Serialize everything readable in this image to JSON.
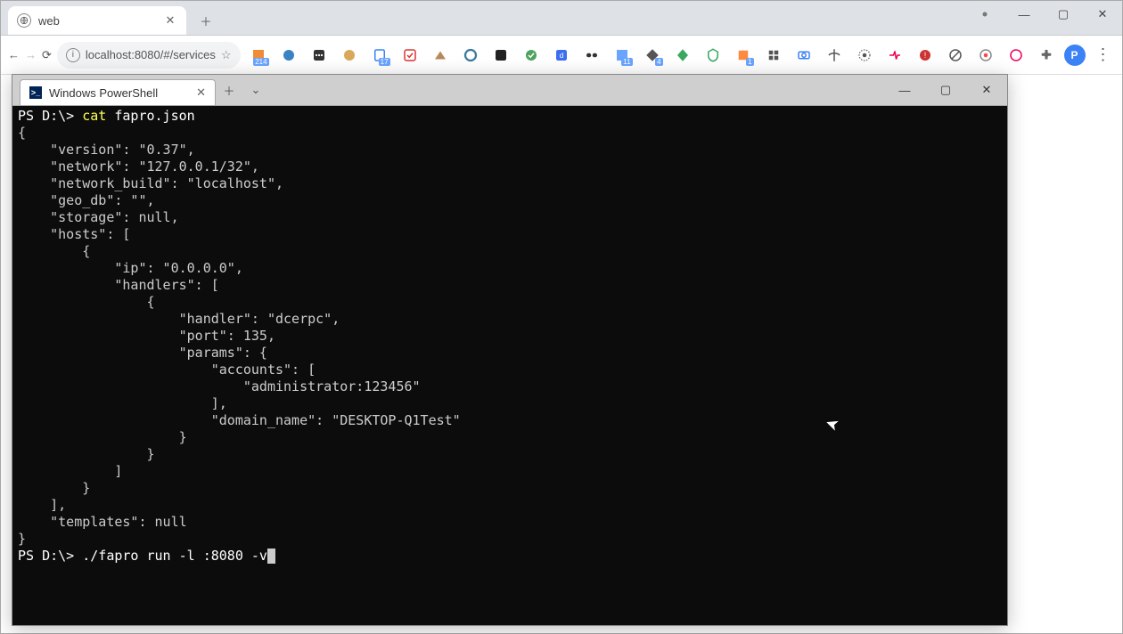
{
  "browser": {
    "tab_title": "web",
    "url": "localhost:8080/#/services",
    "avatar_initial": "P",
    "ext_badge_1": "214",
    "ext_badge_2": "17",
    "ext_badge_3": "11",
    "ext_badge_4": "4",
    "ext_badge_5": "1"
  },
  "terminal": {
    "tab_title": "Windows PowerShell",
    "prompt": "PS D:\\>",
    "cmd1": "cat",
    "cmd1_arg": "fapro.json",
    "cmd2": "./fapro run -l :8080 -v",
    "json_lines": [
      "{",
      "    \"version\": \"0.37\",",
      "    \"network\": \"127.0.0.1/32\",",
      "    \"network_build\": \"localhost\",",
      "    \"geo_db\": \"\",",
      "    \"storage\": null,",
      "    \"hosts\": [",
      "        {",
      "            \"ip\": \"0.0.0.0\",",
      "            \"handlers\": [",
      "                {",
      "                    \"handler\": \"dcerpc\",",
      "                    \"port\": 135,",
      "                    \"params\": {",
      "                        \"accounts\": [",
      "                            \"administrator:123456\"",
      "                        ],",
      "                        \"domain_name\": \"DESKTOP-Q1Test\"",
      "                    }",
      "                }",
      "            ]",
      "        }",
      "    ],",
      "    \"templates\": null",
      "}"
    ]
  },
  "config_data": {
    "version": "0.37",
    "network": "127.0.0.1/32",
    "network_build": "localhost",
    "geo_db": "",
    "storage": null,
    "hosts": [
      {
        "ip": "0.0.0.0",
        "handlers": [
          {
            "handler": "dcerpc",
            "port": 135,
            "params": {
              "accounts": [
                "administrator:123456"
              ],
              "domain_name": "DESKTOP-Q1Test"
            }
          }
        ]
      }
    ],
    "templates": null
  }
}
